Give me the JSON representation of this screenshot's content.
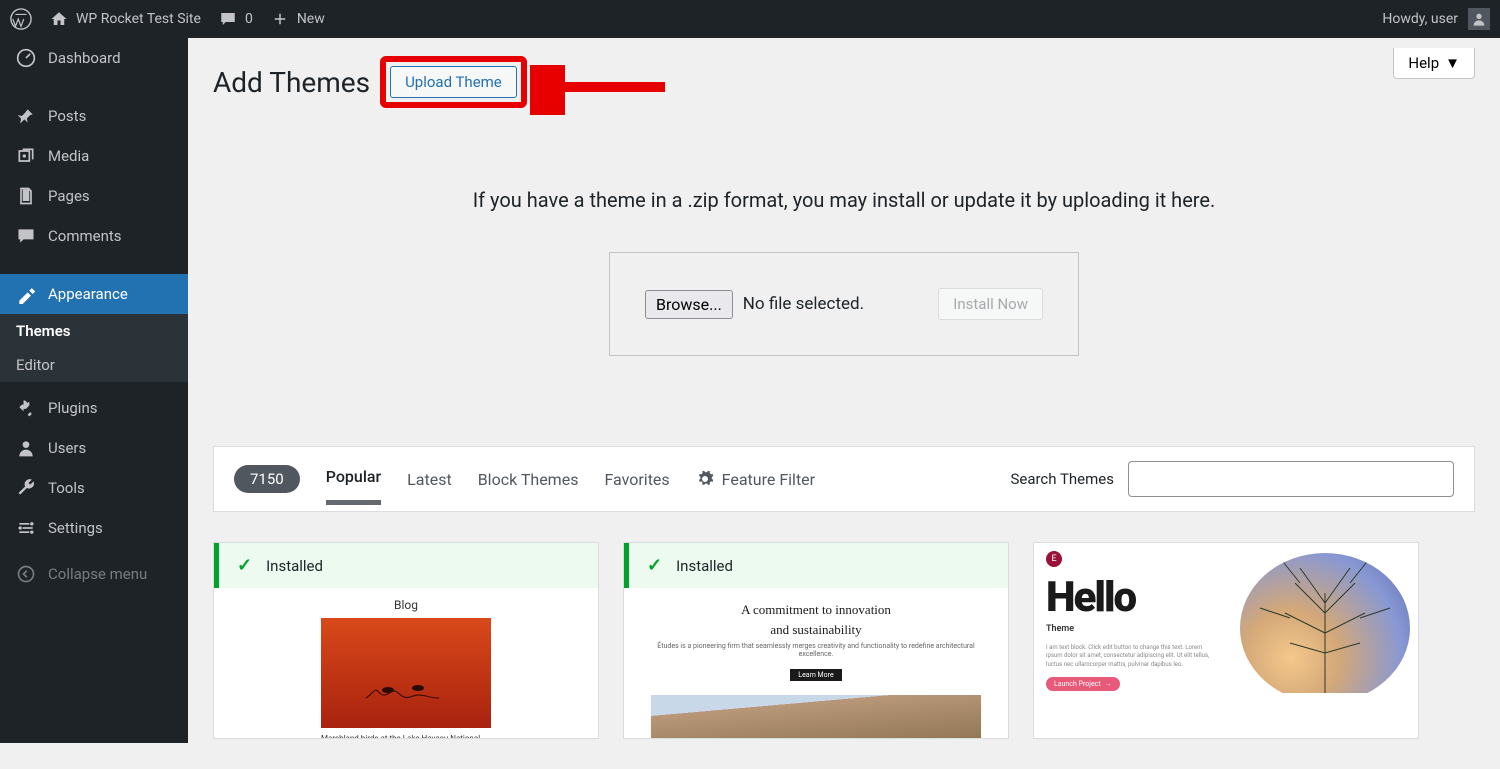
{
  "admin_bar": {
    "site_title": "WP Rocket Test Site",
    "comment_count": "0",
    "new_label": "New",
    "howdy": "Howdy, user"
  },
  "sidebar": {
    "items": [
      {
        "label": "Dashboard",
        "icon": "dashboard-icon"
      },
      {
        "label": "Posts",
        "icon": "pin-icon"
      },
      {
        "label": "Media",
        "icon": "media-icon"
      },
      {
        "label": "Pages",
        "icon": "pages-icon"
      },
      {
        "label": "Comments",
        "icon": "comments-icon"
      },
      {
        "label": "Appearance",
        "icon": "appearance-icon",
        "active": true
      },
      {
        "label": "Plugins",
        "icon": "plugins-icon"
      },
      {
        "label": "Users",
        "icon": "users-icon"
      },
      {
        "label": "Tools",
        "icon": "tools-icon"
      },
      {
        "label": "Settings",
        "icon": "settings-icon"
      },
      {
        "label": "Collapse menu",
        "icon": "collapse-icon"
      }
    ],
    "subitems": [
      {
        "label": "Themes",
        "current": true
      },
      {
        "label": "Editor"
      }
    ]
  },
  "page": {
    "title": "Add Themes",
    "upload_btn": "Upload Theme",
    "help": "Help",
    "instructions": "If you have a theme in a .zip format, you may install or update it by uploading it here.",
    "browse": "Browse...",
    "no_file": "No file selected.",
    "install": "Install Now"
  },
  "filter_bar": {
    "count": "7150",
    "tabs": [
      "Popular",
      "Latest",
      "Block Themes",
      "Favorites"
    ],
    "feature_filter": "Feature Filter",
    "search_label": "Search Themes"
  },
  "themes": {
    "installed_label": "Installed",
    "card1": {
      "blog_title": "Blog",
      "caption": "Marshland birds at the Lake Havasu National Wildlife Refuge"
    },
    "card2": {
      "headline1": "A commitment to innovation",
      "headline2": "and sustainability",
      "sub": "Études is a pioneering firm that seamlessly merges creativity and functionality to redefine architectural excellence.",
      "cta": "Learn More"
    },
    "card3": {
      "hello": "Hello",
      "theme_lbl": "Theme",
      "lorem": "I am text block. Click edit button to change this text. Lorem ipsum dolor sit amet, consectetur adipiscing elit. Ut elit tellus, luctus nec ullamcorper mattis, pulvinar dapibus leo.",
      "launch": "Launch Project"
    }
  }
}
